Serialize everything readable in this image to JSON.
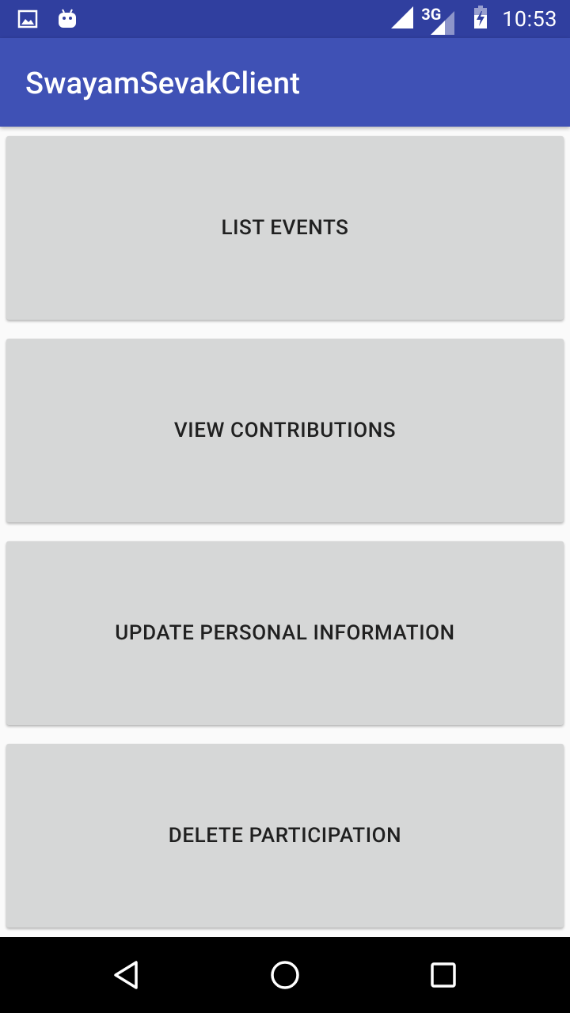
{
  "status_bar": {
    "time": "10:53",
    "network": "3G",
    "left_icons": [
      "image-icon",
      "android-icon"
    ],
    "right_icons": [
      "wifi-signal-icon",
      "cell-signal-icon",
      "battery-charging-icon"
    ]
  },
  "app_bar": {
    "title": "SwayamSevakClient",
    "color": "#3f51b5"
  },
  "buttons": [
    {
      "label": "LIST EVENTS"
    },
    {
      "label": "VIEW CONTRIBUTIONS"
    },
    {
      "label": "UPDATE PERSONAL INFORMATION"
    },
    {
      "label": "DELETE PARTICIPATION"
    }
  ],
  "nav_bar": {
    "icons": [
      "back-icon",
      "home-icon",
      "recents-icon"
    ]
  },
  "colors": {
    "status_bar": "#303f9f",
    "primary": "#3f51b5",
    "button_bg": "#d6d7d7",
    "background": "#fafafa"
  }
}
